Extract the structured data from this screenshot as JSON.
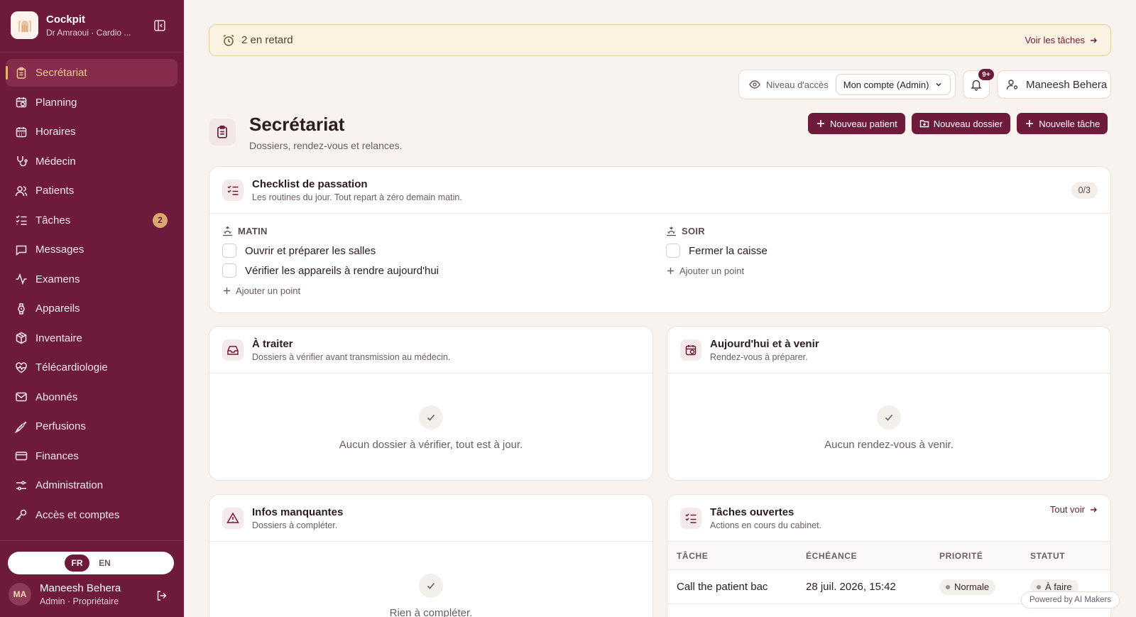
{
  "colors": {
    "brand": "#6e1a3b",
    "accent": "#e9b37e",
    "alert_bg": "#fbf2e2",
    "page_bg": "#f8f3ee"
  },
  "sidebar": {
    "app_title": "Cockpit",
    "app_subtitle": "Dr Amraoui · Cardio ...",
    "items": [
      {
        "label": "Secrétariat",
        "icon": "clipboard-icon",
        "active": true
      },
      {
        "label": "Planning",
        "icon": "calendar-clock-icon"
      },
      {
        "label": "Horaires",
        "icon": "calendar-icon"
      },
      {
        "label": "Médecin",
        "icon": "stethoscope-icon"
      },
      {
        "label": "Patients",
        "icon": "users-icon"
      },
      {
        "label": "Tâches",
        "icon": "list-checks-icon",
        "badge": "2"
      },
      {
        "label": "Messages",
        "icon": "message-square-icon"
      },
      {
        "label": "Examens",
        "icon": "activity-icon"
      },
      {
        "label": "Appareils",
        "icon": "watch-icon"
      },
      {
        "label": "Inventaire",
        "icon": "package-icon"
      },
      {
        "label": "Télécardiologie",
        "icon": "heart-pulse-icon"
      },
      {
        "label": "Abonnés",
        "icon": "mail-icon"
      },
      {
        "label": "Perfusions",
        "icon": "syringe-icon"
      },
      {
        "label": "Finances",
        "icon": "credit-card-icon"
      },
      {
        "label": "Administration",
        "icon": "settings-sliders-icon"
      },
      {
        "label": "Accès et comptes",
        "icon": "key-icon"
      }
    ],
    "lang": {
      "fr": "FR",
      "en": "EN",
      "selected": "FR"
    },
    "user": {
      "initials": "MA",
      "name": "Maneesh Behera",
      "role": "Admin · Propriétaire"
    }
  },
  "alert": {
    "text": "2 en retard",
    "link": "Voir les tâches"
  },
  "topbar": {
    "access_label": "Niveau d'accès",
    "access_value": "Mon compte (Admin)",
    "notif_count": "9+",
    "user_name": "Maneesh Behera"
  },
  "header": {
    "title": "Secrétariat",
    "subtitle": "Dossiers, rendez-vous et relances."
  },
  "actions": {
    "new_patient": "Nouveau patient",
    "new_file": "Nouveau dossier",
    "new_task": "Nouvelle tâche"
  },
  "checklist": {
    "title": "Checklist de passation",
    "subtitle": "Les routines du jour. Tout repart à zéro demain matin.",
    "counter": "0/3",
    "morning": {
      "label": "MATIN",
      "items": [
        "Ouvrir et préparer les salles",
        "Vérifier les appareils à rendre aujourd'hui"
      ],
      "add": "Ajouter un point"
    },
    "evening": {
      "label": "SOIR",
      "items": [
        "Fermer la caisse"
      ],
      "add": "Ajouter un point"
    }
  },
  "to_process": {
    "title": "À traiter",
    "subtitle": "Dossiers à vérifier avant transmission au médecin.",
    "empty": "Aucun dossier à vérifier, tout est à jour."
  },
  "upcoming": {
    "title": "Aujourd'hui et à venir",
    "subtitle": "Rendez-vous à préparer.",
    "empty": "Aucun rendez-vous à venir."
  },
  "missing": {
    "title": "Infos manquantes",
    "subtitle": "Dossiers à compléter.",
    "empty": "Rien à compléter."
  },
  "tasks": {
    "title": "Tâches ouvertes",
    "subtitle": "Actions en cours du cabinet.",
    "link": "Tout voir",
    "columns": [
      "TÂCHE",
      "ÉCHÉANCE",
      "PRIORITÉ",
      "STATUT"
    ],
    "rows": [
      {
        "task": "Call the patient bac",
        "due": "28 juil. 2026, 15:42",
        "priority": "Normale",
        "status": "À faire"
      }
    ]
  },
  "powered": "Powered by AI Makers"
}
